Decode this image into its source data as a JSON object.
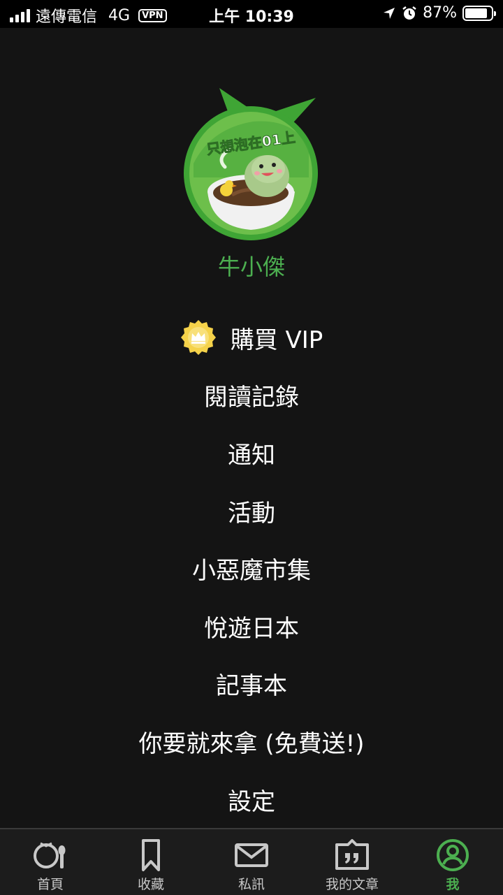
{
  "status_bar": {
    "carrier": "遠傳電信",
    "network": "4G",
    "vpn": "VPN",
    "time": "上午 10:39",
    "battery": "87%",
    "battery_level": 0.87
  },
  "profile": {
    "avatar_caption": "只想泡在01上",
    "username": "牛小傑"
  },
  "menu": {
    "items": [
      {
        "label": "購買 VIP",
        "icon": "vip-crown-icon"
      },
      {
        "label": "閱讀記錄"
      },
      {
        "label": "通知"
      },
      {
        "label": "活動"
      },
      {
        "label": "小惡魔市集"
      },
      {
        "label": "悅遊日本"
      },
      {
        "label": "記事本"
      },
      {
        "label": "你要就來拿 (免費送!)"
      },
      {
        "label": "設定"
      }
    ]
  },
  "tab_bar": {
    "tabs": [
      {
        "label": "首頁",
        "icon": "home-icon"
      },
      {
        "label": "收藏",
        "icon": "bookmark-icon"
      },
      {
        "label": "私訊",
        "icon": "mail-icon"
      },
      {
        "label": "我的文章",
        "icon": "quote-icon"
      },
      {
        "label": "我",
        "icon": "profile-icon",
        "active": true
      }
    ]
  },
  "colors": {
    "background": "#141414",
    "accent": "#4caf50",
    "vip_gold": "#f5d24a"
  }
}
